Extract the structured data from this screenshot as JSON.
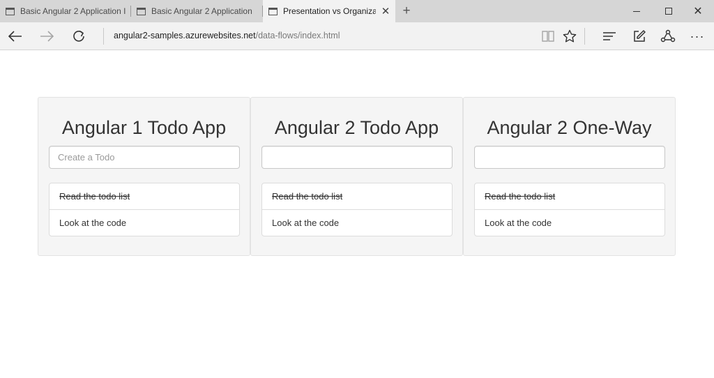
{
  "browser": {
    "tabs": [
      {
        "title": "Basic Angular 2 Application I",
        "active": false
      },
      {
        "title": "Basic Angular 2 Application",
        "active": false
      },
      {
        "title": "Presentation vs Organiza",
        "active": true
      }
    ],
    "url_host": "angular2-samples.azurewebsites.net",
    "url_path": "/data-flows/index.html",
    "icons": {
      "tab": "page-icon",
      "tab_close": "close-icon",
      "new_tab": "plus-icon",
      "minimize": "minimize-icon",
      "maximize": "maximize-icon",
      "close_window": "close-icon",
      "back": "arrow-left-icon",
      "forward": "arrow-right-icon",
      "refresh": "refresh-icon",
      "reading_view": "book-icon",
      "favorite": "star-icon",
      "hub": "hub-icon",
      "web_note": "pen-note-icon",
      "share": "share-icon",
      "more": "more-icon"
    }
  },
  "panels": [
    {
      "title": "Angular 1 Todo App",
      "input_placeholder": "Create a Todo",
      "input_value": "",
      "todos": [
        {
          "text": "Read the todo list",
          "done": true
        },
        {
          "text": "Look at the code",
          "done": false
        }
      ]
    },
    {
      "title": "Angular 2 Todo App",
      "input_placeholder": "",
      "input_value": "",
      "todos": [
        {
          "text": "Read the todo list",
          "done": true
        },
        {
          "text": "Look at the code",
          "done": false
        }
      ]
    },
    {
      "title": "Angular 2 One-Way",
      "input_placeholder": "",
      "input_value": "",
      "todos": [
        {
          "text": "Read the todo list",
          "done": true
        },
        {
          "text": "Look at the code",
          "done": false
        }
      ]
    }
  ],
  "colors": {
    "tabstrip_bg": "#d6d6d6",
    "chrome_bg": "#f2f2f2",
    "panel_bg": "#f5f5f5"
  }
}
